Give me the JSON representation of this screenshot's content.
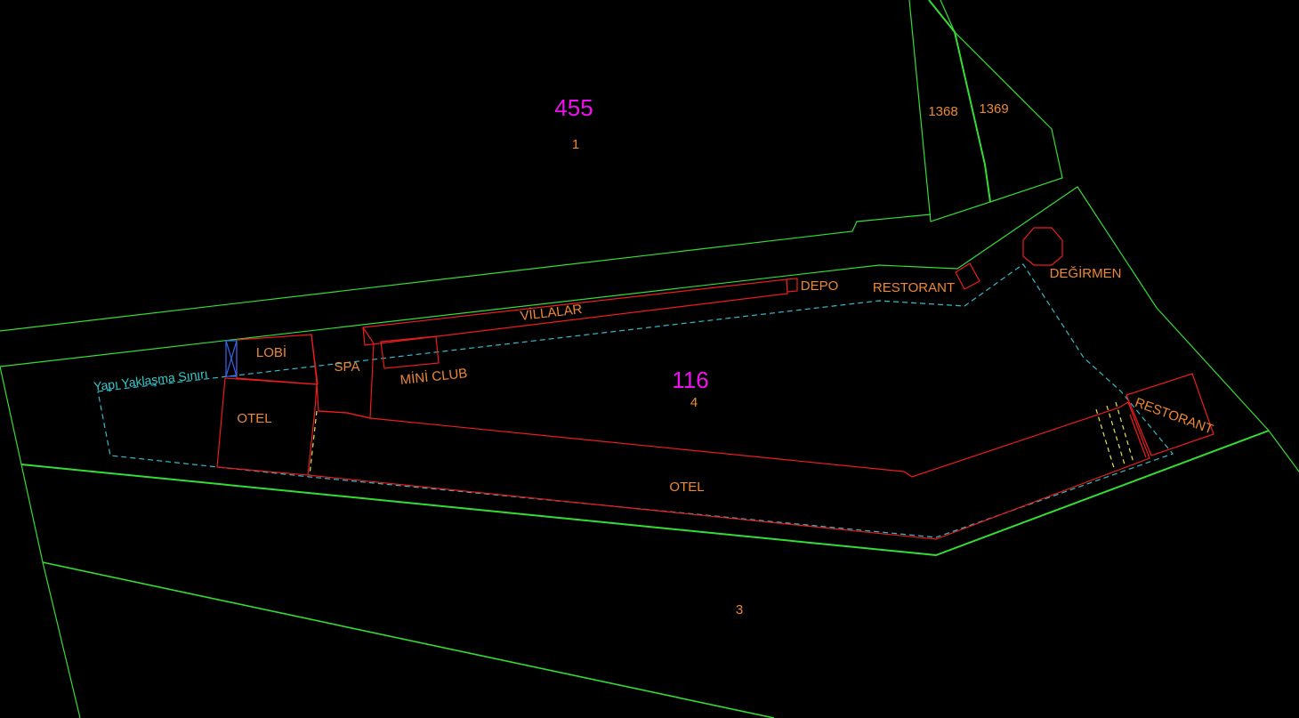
{
  "colors": {
    "background": "#000000",
    "parcel_boundary": "#33dd33",
    "building_outline": "#ee1c1c",
    "setback_line": "#33bbcc",
    "dashed_yellow": "#e6e64d",
    "entrance_blue": "#3366ee",
    "parcel_number": "#ee11ee",
    "building_label": "#ee8833",
    "setback_label": "#33cccc"
  },
  "parcels": {
    "p455": "455",
    "p455_sub": "1",
    "p116": "116",
    "p116_sub": "4",
    "p1368": "1368",
    "p1369": "1369",
    "south_sub": "3"
  },
  "buildings": {
    "lobi": "LOBİ",
    "otel_west": "OTEL",
    "spa": "SPA",
    "villalar": "VİLLALAR",
    "mini_club": "MİNİ CLUB",
    "depo": "DEPO",
    "restorant_north": "RESTORANT",
    "degirmen": "DEĞİRMEN",
    "restorant_east": "RESTORANT",
    "otel_south": "OTEL"
  },
  "annotations": {
    "setback_boundary": "Yapı Yaklaşma Sınırı"
  }
}
